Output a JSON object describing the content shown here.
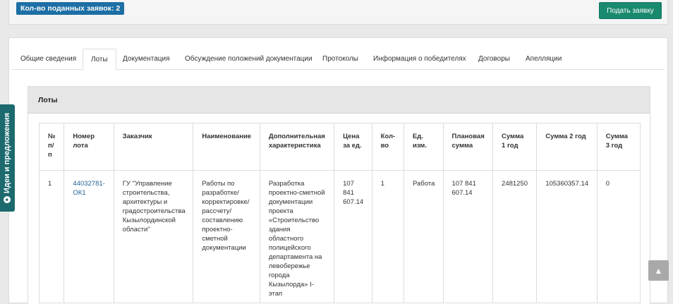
{
  "top_panel": {
    "count_label": "Кол-во поданных заявок: 2",
    "submit_button": "Подать заявку"
  },
  "tabs": [
    {
      "label": "Общие сведения",
      "active": false
    },
    {
      "label": "Лоты",
      "active": true
    },
    {
      "label": "Документация",
      "active": false
    },
    {
      "label": "Обсуждение положений документации",
      "active": false
    },
    {
      "label": "Протоколы",
      "active": false
    },
    {
      "label": "Информация о победителях",
      "active": false
    },
    {
      "label": "Договоры",
      "active": false
    },
    {
      "label": "Апелляции",
      "active": false
    }
  ],
  "lots": {
    "title": "Лоты",
    "columns": [
      "№\nп/\nп",
      "Номер\nлота",
      "Заказчик",
      "Наименование",
      "Дополнительная\nхарактеристика",
      "Цена\nза ед.",
      "Кол-\nво",
      "Ед.\nизм.",
      "Плановая\nсумма",
      "Сумма\n1 год",
      "Сумма 2 год",
      "Сумма\n3 год"
    ],
    "rows": [
      {
        "num": "1",
        "lot_number": "44032781-\nОК1",
        "customer": "ГУ \"Управление\nстроительства,\nархитектуры и\nградостроительства\nКызылординской\nобласти\"",
        "name": "Работы по\nразработке/\nкорректировке/\nрассчету/\nсоставлению\nпроектно-\nсметной\nдокументации",
        "extra": "Разработка\nпроектно-сметной\nдокументации\nпроекта\n«Строительство\nздания\nобластного\nполицейского\nдепартамента на\nлевобережье\nгорода\nКызылорда» I-\nэтап",
        "price": "107\n841\n607.14",
        "qty": "1",
        "unit": "Работа",
        "planned": "107 841\n607.14",
        "sum1": "2481250",
        "sum2": "105360357.14",
        "sum3": "0"
      }
    ]
  },
  "side_tab": {
    "label": "Идеи и предложения",
    "icon": "lightbulb-icon"
  },
  "scroll_top": {
    "icon": "chevron-up-icon"
  }
}
